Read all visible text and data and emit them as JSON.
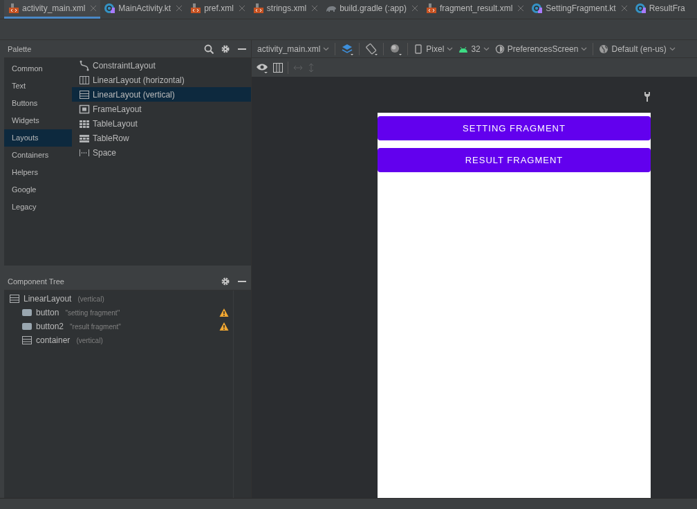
{
  "tabs": [
    {
      "label": "activity_main.xml",
      "kind": "xml",
      "selected": true
    },
    {
      "label": "MainActivity.kt",
      "kind": "kotlin",
      "selected": false
    },
    {
      "label": "pref.xml",
      "kind": "xml",
      "selected": false
    },
    {
      "label": "strings.xml",
      "kind": "xml",
      "selected": false
    },
    {
      "label": "build.gradle (:app)",
      "kind": "gradle",
      "selected": false
    },
    {
      "label": "fragment_result.xml",
      "kind": "xml",
      "selected": false
    },
    {
      "label": "SettingFragment.kt",
      "kind": "kotlin",
      "selected": false
    },
    {
      "label": "ResultFra",
      "kind": "kotlin",
      "selected": false
    }
  ],
  "palette": {
    "title": "Palette",
    "categories": [
      {
        "label": "Common",
        "selected": false
      },
      {
        "label": "Text",
        "selected": false
      },
      {
        "label": "Buttons",
        "selected": false
      },
      {
        "label": "Widgets",
        "selected": false
      },
      {
        "label": "Layouts",
        "selected": true
      },
      {
        "label": "Containers",
        "selected": false
      },
      {
        "label": "Helpers",
        "selected": false
      },
      {
        "label": "Google",
        "selected": false
      },
      {
        "label": "Legacy",
        "selected": false
      }
    ],
    "items": [
      {
        "label": "ConstraintLayout",
        "kind": "constraint",
        "selected": false
      },
      {
        "label": "LinearLayout (horizontal)",
        "kind": "linear-h",
        "selected": false
      },
      {
        "label": "LinearLayout (vertical)",
        "kind": "linear-v",
        "selected": true
      },
      {
        "label": "FrameLayout",
        "kind": "frame",
        "selected": false
      },
      {
        "label": "TableLayout",
        "kind": "table",
        "selected": false
      },
      {
        "label": "TableRow",
        "kind": "tablerow",
        "selected": false
      },
      {
        "label": "Space",
        "kind": "space",
        "selected": false
      }
    ]
  },
  "design_toolbar": {
    "file": "activity_main.xml",
    "device": "Pixel",
    "api": "32",
    "theme": "PreferencesScreen",
    "locale": "Default (en-us)"
  },
  "component_tree": {
    "title": "Component Tree",
    "nodes": [
      {
        "name": "LinearLayout",
        "detail": "(vertical)",
        "kind": "linear-v",
        "warning": false,
        "children": [
          {
            "name": "button",
            "detail": "\"setting fragment\"",
            "kind": "button",
            "warning": true
          },
          {
            "name": "button2",
            "detail": "\"result fragment\"",
            "kind": "button",
            "warning": true
          },
          {
            "name": "container",
            "detail": "(vertical)",
            "kind": "linear-v",
            "warning": false
          }
        ]
      }
    ]
  },
  "preview": {
    "buttons": [
      "SETTING FRAGMENT",
      "RESULT FRAGMENT"
    ]
  }
}
